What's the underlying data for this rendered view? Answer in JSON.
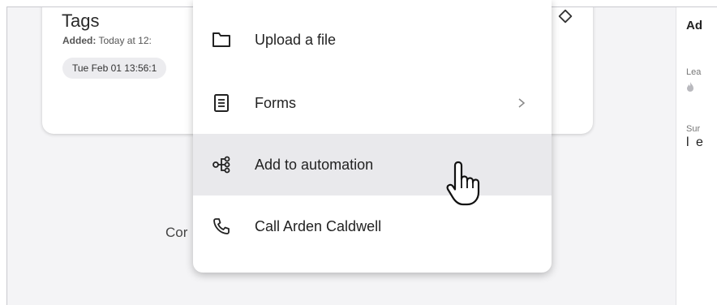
{
  "card": {
    "title": "Tags",
    "added_label": "Added:",
    "added_value": "Today at 12:",
    "chip_text": "Tue Feb 01 13:56:1"
  },
  "background": {
    "partial_text": "Cor"
  },
  "right_panel": {
    "title": "Ad",
    "label1": "Lea",
    "label2": "Sur",
    "value": "l e",
    "icon": "fire-icon"
  },
  "menu": {
    "items": [
      {
        "label": "Upload a file",
        "icon": "folder-icon"
      },
      {
        "label": "Forms",
        "icon": "form-icon",
        "has_submenu": true
      },
      {
        "label": "Add to automation",
        "icon": "automation-icon",
        "hovered": true
      },
      {
        "label": "Call Arden Caldwell",
        "icon": "phone-icon"
      }
    ]
  },
  "colors": {
    "background": "#f4f4f6",
    "menu_hover": "#e9e9ec",
    "text": "#222222"
  }
}
